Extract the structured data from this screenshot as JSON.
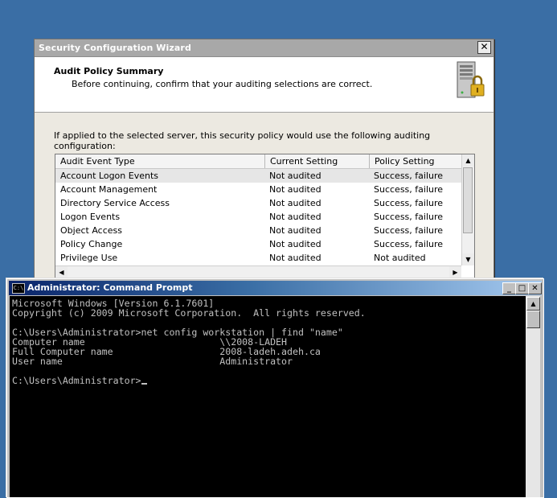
{
  "wizard": {
    "title": "Security Configuration Wizard",
    "close_label": "✕",
    "header": {
      "title": "Audit Policy Summary",
      "subtitle": "Before continuing, confirm that your auditing selections are correct."
    },
    "intro": "If applied to the selected server, this security policy would use the following auditing configuration:",
    "columns": [
      "Audit Event Type",
      "Current Setting",
      "Policy Setting"
    ],
    "rows": [
      [
        "Account Logon Events",
        "Not audited",
        "Success, failure"
      ],
      [
        "Account Management",
        "Not audited",
        "Success, failure"
      ],
      [
        "Directory Service Access",
        "Not audited",
        "Success, failure"
      ],
      [
        "Logon Events",
        "Not audited",
        "Success, failure"
      ],
      [
        "Object Access",
        "Not audited",
        "Success, failure"
      ],
      [
        "Policy Change",
        "Not audited",
        "Success, failure"
      ],
      [
        "Privilege Use",
        "Not audited",
        "Not audited"
      ]
    ],
    "selected_row": 0,
    "icons": {
      "header_icon": "server-lock-icon",
      "scroll_up": "▲",
      "scroll_down": "▼",
      "scroll_left": "◀",
      "scroll_right": "▶"
    }
  },
  "cmd": {
    "title": "Administrator: Command Prompt",
    "icon_text": "C:\\",
    "buttons": {
      "minimize": "_",
      "maximize": "□",
      "close": "✕"
    },
    "lines": [
      "Microsoft Windows [Version 6.1.7601]",
      "Copyright (c) 2009 Microsoft Corporation.  All rights reserved.",
      "",
      "C:\\Users\\Administrator>net config workstation | find \"name\"",
      "Computer name                        \\\\2008-LADEH",
      "Full Computer name                   2008-ladeh.adeh.ca",
      "User name                            Administrator",
      "",
      "C:\\Users\\Administrator>"
    ],
    "colors": {
      "background": "#000000",
      "foreground": "#c0c0c0"
    }
  },
  "desktop": {
    "background": "#3a6ea5"
  }
}
